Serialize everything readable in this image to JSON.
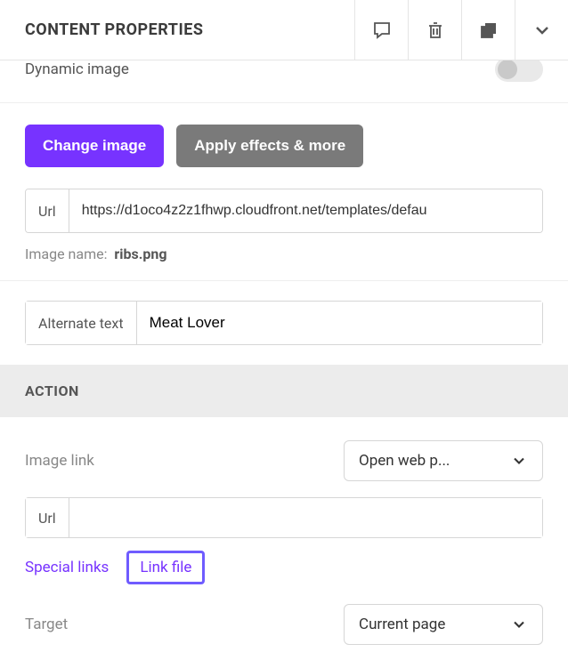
{
  "header": {
    "title": "CONTENT PROPERTIES"
  },
  "dynamic": {
    "label": "Dynamic image"
  },
  "image": {
    "change_btn": "Change image",
    "effects_btn": "Apply effects & more",
    "url_label": "Url",
    "url_value": "https://d1oco4z2z1fhwp.cloudfront.net/templates/defau",
    "name_label": "Image name:",
    "name_value": "ribs.png"
  },
  "alt": {
    "label": "Alternate text",
    "value": "Meat Lover"
  },
  "action": {
    "header": "ACTION",
    "image_link_label": "Image link",
    "image_link_value": "Open web p...",
    "url_label": "Url",
    "url_value": "",
    "special_links": "Special links",
    "link_file": "Link file",
    "target_label": "Target",
    "target_value": "Current page"
  }
}
